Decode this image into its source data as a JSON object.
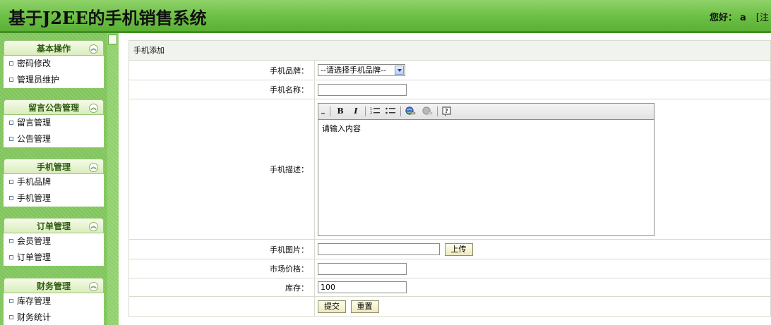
{
  "header": {
    "title": "基于J2EE的手机销售系统",
    "greeting_label": "您好：",
    "username": "a",
    "bracket_text": "[注"
  },
  "sidebar": {
    "sections": [
      {
        "title": "基本操作",
        "items": [
          "密码修改",
          "管理员维护"
        ]
      },
      {
        "title": "留言公告管理",
        "items": [
          "留言管理",
          "公告管理"
        ]
      },
      {
        "title": "手机管理",
        "items": [
          "手机品牌",
          "手机管理"
        ]
      },
      {
        "title": "订单管理",
        "items": [
          "会员管理",
          "订单管理"
        ]
      },
      {
        "title": "财务管理",
        "items": [
          "库存管理",
          "财务统计"
        ]
      }
    ]
  },
  "form": {
    "panel_title": "手机添加",
    "brand_label": "手机品牌：",
    "brand_selected": "--请选择手机品牌--",
    "name_label": "手机名称：",
    "name_value": "",
    "desc_label": "手机描述：",
    "desc_text": "请输入内容",
    "image_label": "手机图片：",
    "image_value": "",
    "upload_button": "上传",
    "price_label": "市场价格：",
    "price_value": "",
    "stock_label": "库存：",
    "stock_value": "100",
    "submit_button": "提交",
    "reset_button": "重置"
  },
  "editor_toolbar": {
    "bold": "B",
    "italic": "I",
    "icons": [
      "ordered-list-icon",
      "unordered-list-icon",
      "link-icon",
      "unlink-icon",
      "help-icon"
    ]
  }
}
